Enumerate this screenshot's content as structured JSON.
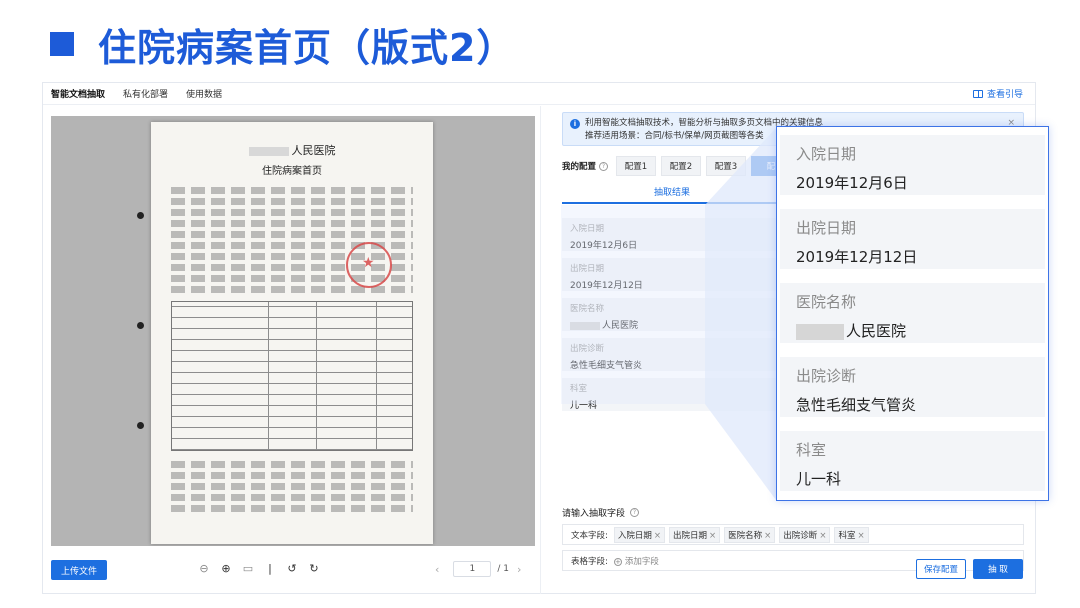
{
  "slide": {
    "title": "住院病案首页（版式2）"
  },
  "nav": {
    "items": [
      "智能文档抽取",
      "私有化部署",
      "使用数据"
    ],
    "guide": "查看引导"
  },
  "document": {
    "hospital": "人民医院",
    "form_title": "住院病案首页"
  },
  "left": {
    "upload": "上传文件",
    "page_current": "1",
    "page_total": "/ 1"
  },
  "notice": {
    "line1": "利用智能文档抽取技术，智能分析与抽取多页文档中的关键信息",
    "line2": "推荐适用场景：合同/标书/保单/网页截图等各类",
    "close": "×"
  },
  "config": {
    "label": "我的配置",
    "tabs": [
      "配置1",
      "配置2",
      "配置3",
      "配"
    ]
  },
  "result_tab": "抽取结果",
  "fields": [
    {
      "label": "入院日期",
      "value": "2019年12月6日"
    },
    {
      "label": "出院日期",
      "value": "2019年12月12日"
    },
    {
      "label": "医院名称",
      "value": "人民医院"
    },
    {
      "label": "出院诊断",
      "value": "急性毛细支气管炎"
    },
    {
      "label": "科室",
      "value": "儿一科"
    }
  ],
  "input_section": {
    "label": "请输入抽取字段",
    "text_label": "文本字段:",
    "text_tags": [
      "入院日期",
      "出院日期",
      "医院名称",
      "出院诊断",
      "科室"
    ],
    "table_label": "表格字段:",
    "add_field": "添加字段"
  },
  "buttons": {
    "save": "保存配置",
    "extract": "抽 取"
  },
  "colors": {
    "accent": "#1d6fe0",
    "title": "#1d5bd8"
  }
}
